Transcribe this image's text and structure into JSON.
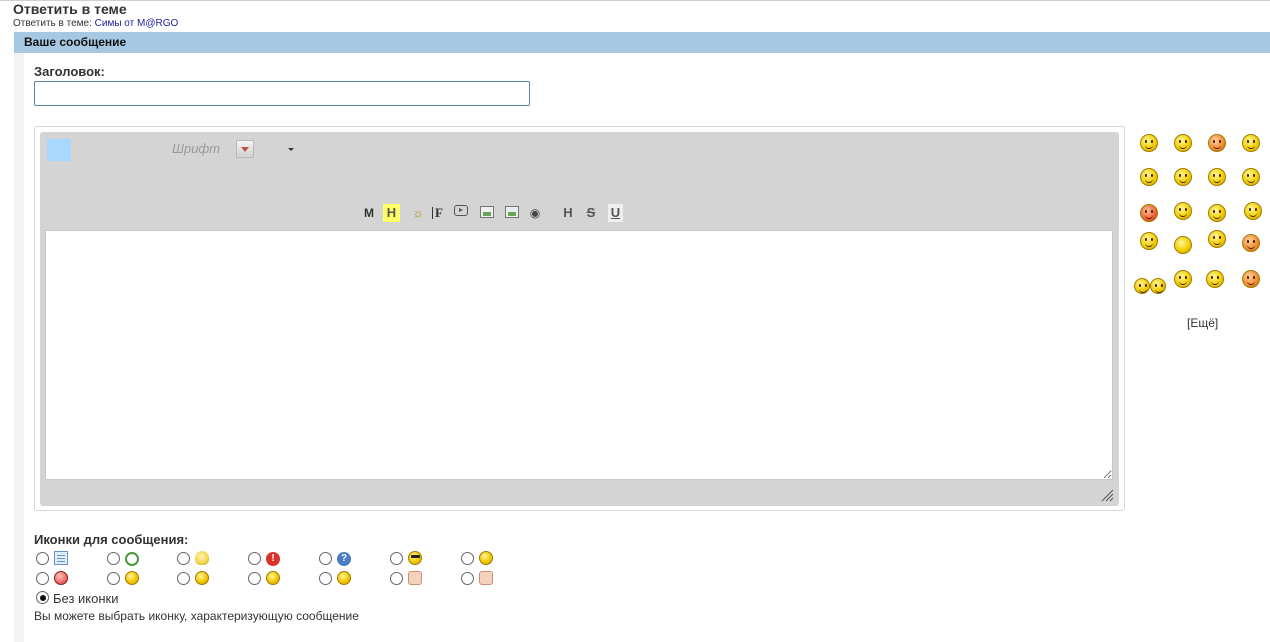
{
  "header": {
    "title": "Ответить в теме",
    "crumb_prefix": "Ответить в теме:",
    "crumb_link": "Симы от M@RGO"
  },
  "form": {
    "section_title": "Ваше сообщение",
    "title_label": "Заголовок:",
    "title_value": "",
    "title_placeholder": ""
  },
  "editor": {
    "font_label": "Шрифт",
    "toolbar": [
      "М",
      "Н",
      "☼",
      "F",
      "▶",
      "img",
      "img",
      "◉",
      "Н",
      "S",
      "U"
    ],
    "text_value": "",
    "swatch_color": "#a9d8ff"
  },
  "smilies": {
    "more_label": "[Ещё]",
    "count": 20
  },
  "post_icons": {
    "label": "Иконки для сообщения:",
    "no_icon_label": "Без иконки",
    "hint": "Вы можете выбрать иконку, характеризующую сообщение",
    "row1": [
      "doc-icon",
      "refresh-icon",
      "bulb-icon",
      "exclamation-icon",
      "question-icon",
      "cool-icon",
      "smile-icon"
    ],
    "row2": [
      "angry-icon",
      "sad-icon",
      "laugh-icon",
      "happy-icon",
      "grin-icon",
      "thumbs-down-icon",
      "thumbs-up-icon"
    ]
  },
  "colors": {
    "section_bar": "#a6c8e2",
    "link": "#22229c",
    "editor_bg": "#d4d4d4"
  }
}
